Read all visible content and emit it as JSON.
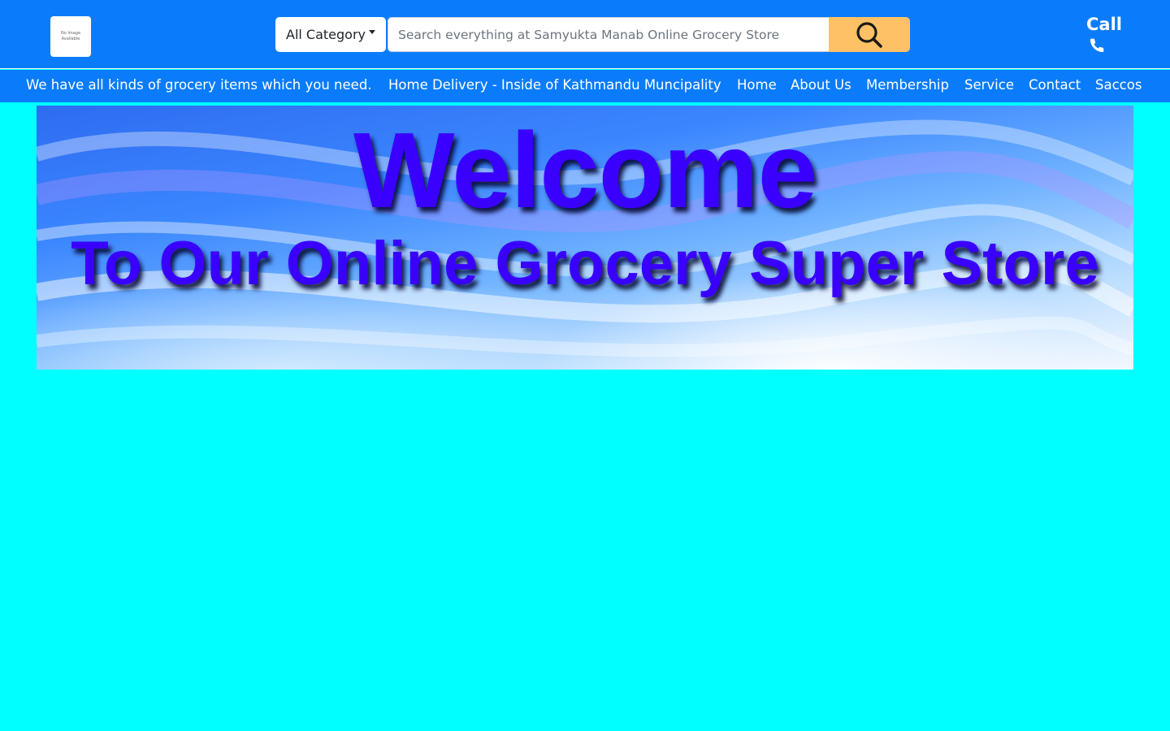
{
  "header": {
    "logo_text": "No Image Available",
    "category_label": "All Category",
    "search_placeholder": "Search everything at Samyukta Manab Online Grocery Store",
    "search_value": "",
    "call_label": "Call",
    "icons": {
      "search": "search-icon",
      "phone": "phone-icon",
      "dropdown": "caret-down-icon"
    },
    "colors": {
      "header_bg": "#0a7cfb",
      "search_button_bg": "#ffc166"
    }
  },
  "navbar": {
    "tagline": "We have all kinds of grocery items which you need.",
    "delivery_note": "Home Delivery - Inside of Kathmandu Muncipality",
    "links": [
      "Home",
      "About Us",
      "Membership",
      "Service",
      "Contact",
      "Saccos"
    ]
  },
  "banner": {
    "title": "Welcome",
    "subtitle": "To Our Online Grocery Super Store",
    "text_color": "#3a00ff"
  },
  "page": {
    "background": "#00ffff"
  }
}
